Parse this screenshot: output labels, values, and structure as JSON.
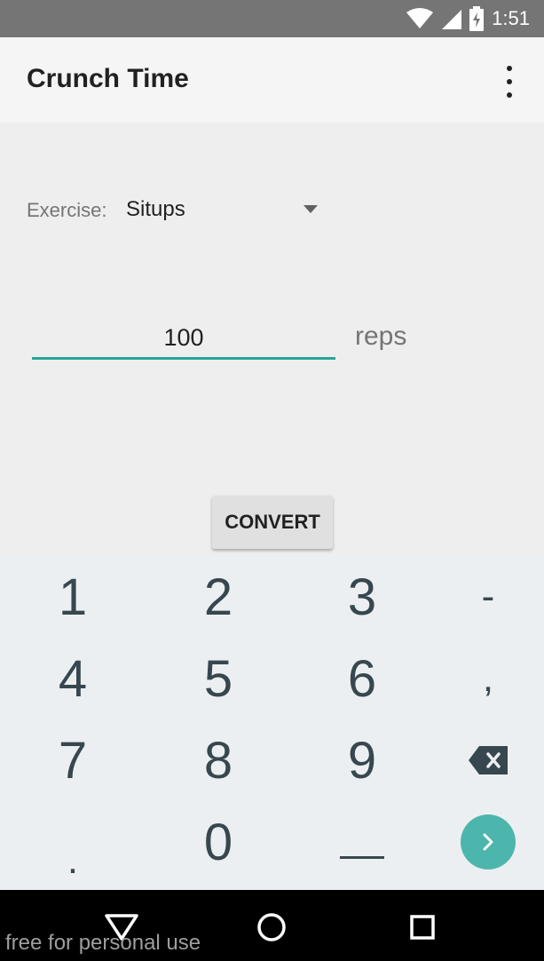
{
  "status_bar": {
    "time": "1:51",
    "icons": [
      "wifi-icon",
      "signal-icon",
      "battery-charging-icon"
    ],
    "background": "#757575"
  },
  "app_bar": {
    "title": "Crunch Time",
    "overflow_icon": "more-vert-icon"
  },
  "form": {
    "exercise_label": "Exercise:",
    "exercise_selected": "Situps",
    "reps_value": "100",
    "reps_unit": "reps",
    "convert_label": "CONVERT",
    "accent_color": "#26a69a"
  },
  "keyboard": {
    "rows": [
      [
        "1",
        "2",
        "3",
        "-"
      ],
      [
        "4",
        "5",
        "6",
        ","
      ],
      [
        "7",
        "8",
        "9",
        "backspace"
      ],
      [
        ".",
        "0",
        "_",
        "next"
      ]
    ],
    "enter_color": "#4db6ac"
  },
  "nav_bar": {
    "buttons": [
      "back-icon",
      "home-icon",
      "recents-icon"
    ]
  },
  "watermark": "free for personal use"
}
